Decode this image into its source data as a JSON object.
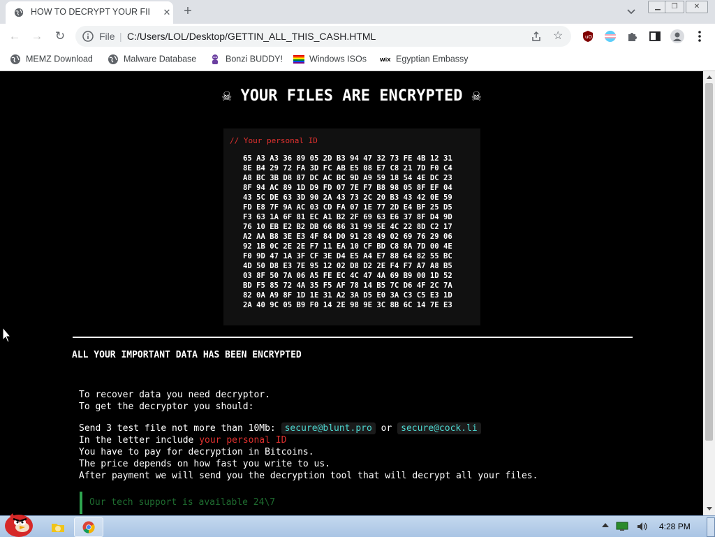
{
  "browser": {
    "tab_title": "HOW TO DECRYPT YOUR FILE",
    "new_tab_label": "+",
    "address_protocol": "File",
    "address_url": "C:/Users/LOL/Desktop/GETTIN_ALL_THIS_CASH.HTML",
    "bookmarks": [
      {
        "label": "MEMZ Download",
        "icon": "globe-icon"
      },
      {
        "label": "Malware Database",
        "icon": "globe-icon"
      },
      {
        "label": "Bonzi BUDDY!",
        "icon": "bonzi-icon"
      },
      {
        "label": "Windows ISOs",
        "icon": "rainbow-flag-icon"
      },
      {
        "label": "Egyptian Embassy",
        "icon": "wix-icon"
      }
    ]
  },
  "page": {
    "heading": "☠ YOUR FILES ARE ENCRYPTED ☠",
    "id_comment": "// Your personal ID",
    "id_hex": "65 A3 A3 36 89 05 2D B3 94 47 32 73 FE 4B 12 31\n8E B4 29 72 FA 3D FC AB E5 08 E7 C8 21 7D F0 C4\nA8 BC 3B D8 87 DC AC BC 9D A9 59 18 54 4E DC 23\n8F 94 AC 89 1D D9 FD 07 7E F7 B8 98 05 8F EF 04\n43 5C DE 63 3D 90 2A 43 73 2C 20 B3 43 42 0E 59\nFD E8 7F 9A AC 03 CD FA 07 1E 77 2D E4 BF 25 D5\nF3 63 1A 6F 81 EC A1 B2 2F 69 63 E6 37 8F D4 9D\n76 10 EB E2 B2 DB 66 86 31 99 5E 4C 22 8D C2 17\nA2 AA B8 3E E3 4F 84 D0 91 28 49 02 69 76 29 06\n92 1B 0C 2E 2E F7 11 EA 10 CF BD C8 8A 7D 00 4E\nF0 9D 47 1A 3F CF 3E D4 E5 A4 E7 88 64 82 55 BC\n4D 50 D8 E3 7E 95 12 02 D8 D2 2E F4 F7 A7 A8 B5\n03 8F 50 7A 06 A5 FE EC 4C 47 4A 69 B9 00 1D 52\nBD F5 85 72 4A 35 F5 AF 78 14 B5 7C D6 4F 2C 7A\n82 0A A9 8F 1D 1E 31 A2 3A D5 E0 3A C3 C5 E3 1D\n2A 40 9C 05 B9 F0 14 2E 98 9E 3C 8B 6C 14 7E E3",
    "subheading": "ALL YOUR IMPORTANT DATA HAS BEEN ENCRYPTED",
    "line1": "To recover data you need decryptor.",
    "line2": "To get the decryptor you should:",
    "send_prefix": "Send 3 test file not more than 10Mb:",
    "email1": "secure@blunt.pro",
    "or_word": "or",
    "email2": "secure@cock.li",
    "include_prefix": "In the letter include",
    "include_highlight": "your personal ID",
    "line_pay": "You have to pay for decryption in Bitcoins.",
    "line_price": "The price depends on how fast you write to us.",
    "line_after": "After payment we will send you the decryption tool that will decrypt all your files.",
    "support": "Our tech support is available 24\\7"
  },
  "taskbar": {
    "clock": "4:28 PM"
  },
  "colors": {
    "accent_red": "#e0312f",
    "email_cyan": "#4dd7d0",
    "support_green": "#2ea44f"
  }
}
